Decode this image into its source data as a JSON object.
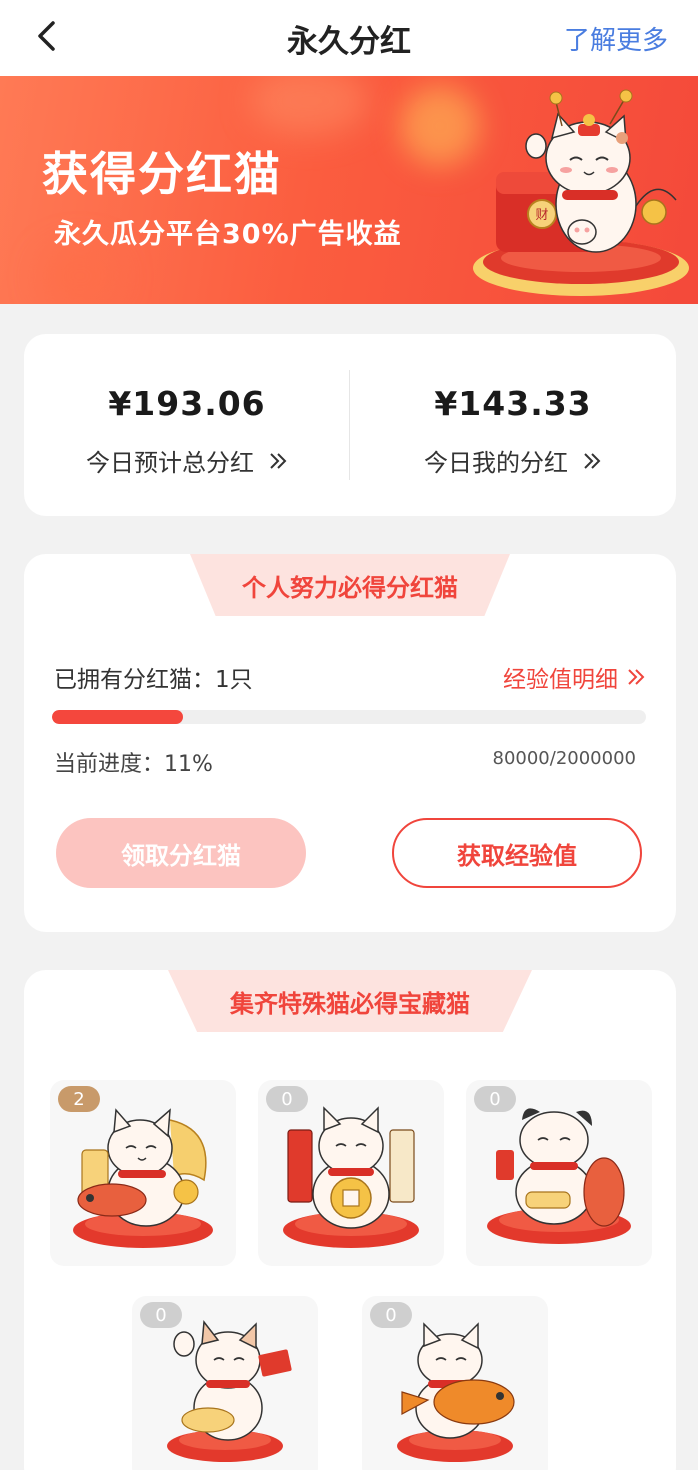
{
  "nav": {
    "title": "永久分红",
    "more_label": "了解更多"
  },
  "banner": {
    "title": "获得分红猫",
    "subtitle": "永久瓜分平台30%广告收益"
  },
  "earnings": {
    "total": {
      "amount": "¥193.06",
      "label": "今日预计总分红"
    },
    "mine": {
      "amount": "¥143.33",
      "label": "今日我的分红"
    }
  },
  "personal": {
    "title": "个人努力必得分红猫",
    "owned_label": "已拥有分红猫：1只",
    "exp_link": "经验值明细",
    "progress_fraction": 0.22,
    "progress_label": "当前进度：11%",
    "progress_count": "80000/2000000",
    "claim_button": "领取分红猫",
    "get_exp_button": "获取经验值"
  },
  "collect": {
    "title": "集齐特殊猫必得宝藏猫",
    "cats": [
      {
        "count": "2"
      },
      {
        "count": "0"
      },
      {
        "count": "0"
      },
      {
        "count": "0"
      },
      {
        "count": "0"
      }
    ]
  },
  "icons": {
    "back": "back-chevron-icon",
    "double_chevron": "double-chevron-right-icon"
  },
  "colors": {
    "accent": "#f0453c",
    "link_blue": "#4a7de0",
    "banner_start": "#ff7a55",
    "banner_end": "#f4493a"
  }
}
